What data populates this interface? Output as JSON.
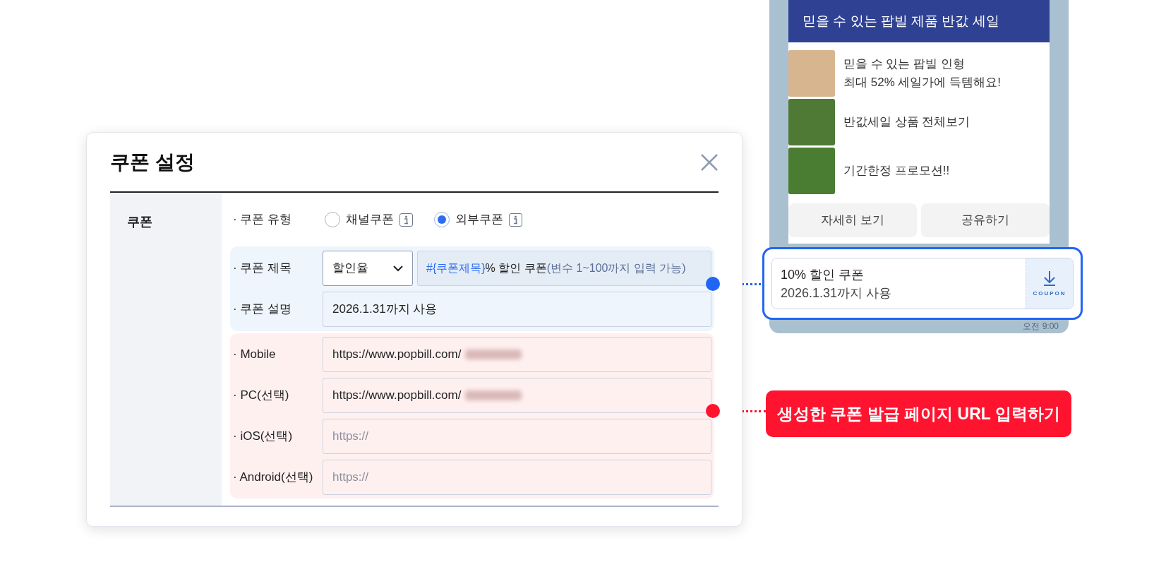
{
  "dialog": {
    "title": "쿠폰 설정",
    "section_label": "쿠폰",
    "type_row": {
      "label": "· 쿠폰 유형",
      "options": [
        {
          "label": "채널쿠폰",
          "selected": false
        },
        {
          "label": "외부쿠폰",
          "selected": true
        }
      ]
    },
    "coupon_rows": [
      {
        "kind": "select_template",
        "label": "· 쿠폰 제목",
        "select_value": "할인율",
        "parts": [
          {
            "kind": "variable",
            "text": "#{쿠폰제목}"
          },
          {
            "kind": "text",
            "text": "% 할인 쿠폰 "
          },
          {
            "kind": "hint",
            "text": "(변수 1~100까지 입력 가능)"
          }
        ]
      },
      {
        "kind": "input",
        "label": "· 쿠폰 설명",
        "value": "2026.1.31까지 사용"
      }
    ],
    "url_rows": [
      {
        "kind": "input",
        "label": "· Mobile",
        "value": "https://www.popbill.com/",
        "redacted": true
      },
      {
        "kind": "input",
        "label": "· PC(선택)",
        "value": "https://www.popbill.com/",
        "redacted": true
      },
      {
        "kind": "input",
        "label": "· iOS(선택)",
        "placeholder": "https://"
      },
      {
        "kind": "input",
        "label": "· Android(선택)",
        "placeholder": "https://"
      }
    ]
  },
  "preview": {
    "banner": "믿을 수 있는 팝빌 제품 반값 세일",
    "items": [
      {
        "text": "믿을 수 있는 팝빌 인형\n최대 52% 세일가에 득템해요!"
      },
      {
        "text": "반값세일 상품 전체보기"
      },
      {
        "text": "기간한정 프로모션!!"
      }
    ],
    "buttons": [
      "자세히 보기",
      "공유하기"
    ],
    "coupon": {
      "title": "10% 할인 쿠폰",
      "subtitle": "2026.1.31까지 사용",
      "badge": "COUPON"
    },
    "time": "오전 9:00"
  },
  "callout": "생성한 쿠폰 발급 페이지 URL 입력하기"
}
